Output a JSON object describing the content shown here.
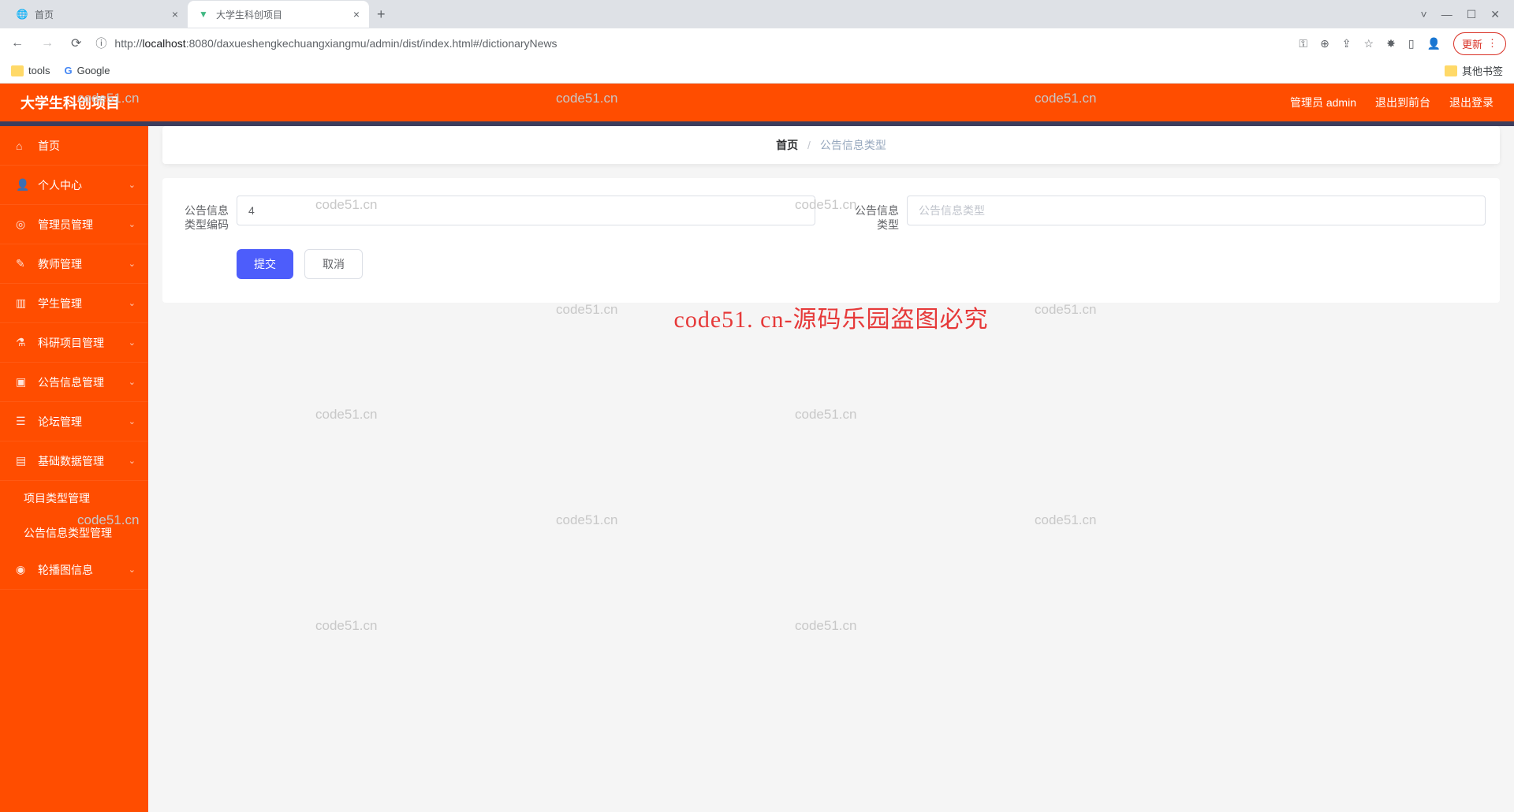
{
  "browser": {
    "tabs": [
      {
        "title": "首页",
        "active": false
      },
      {
        "title": "大学生科创项目",
        "active": true
      }
    ],
    "url_prefix": "http://",
    "url_host": "localhost",
    "url_port": ":8080",
    "url_path": "/daxueshengkechuangxiangmu/admin/dist/index.html#/dictionaryNews",
    "update_label": "更新",
    "bookmarks": {
      "tools": "tools",
      "google": "Google",
      "other": "其他书签"
    }
  },
  "header": {
    "title": "大学生科创项目",
    "user": "管理员 admin",
    "exit_front": "退出到前台",
    "logout": "退出登录"
  },
  "sidebar": {
    "items": [
      {
        "label": "首页",
        "expandable": false
      },
      {
        "label": "个人中心",
        "expandable": true
      },
      {
        "label": "管理员管理",
        "expandable": true
      },
      {
        "label": "教师管理",
        "expandable": true
      },
      {
        "label": "学生管理",
        "expandable": true
      },
      {
        "label": "科研项目管理",
        "expandable": true
      },
      {
        "label": "公告信息管理",
        "expandable": true
      },
      {
        "label": "论坛管理",
        "expandable": true
      },
      {
        "label": "基础数据管理",
        "expandable": true,
        "expanded": true,
        "children": [
          {
            "label": "项目类型管理"
          },
          {
            "label": "公告信息类型管理"
          }
        ]
      },
      {
        "label": "轮播图信息",
        "expandable": true
      }
    ]
  },
  "breadcrumb": {
    "home": "首页",
    "current": "公告信息类型"
  },
  "form": {
    "label_code": "公告信息类型编码",
    "value_code": "4",
    "label_type": "公告信息类型",
    "placeholder_type": "公告信息类型",
    "submit": "提交",
    "cancel": "取消"
  },
  "watermark": {
    "big": "code51. cn-源码乐园盗图必究",
    "small": "code51.cn"
  }
}
